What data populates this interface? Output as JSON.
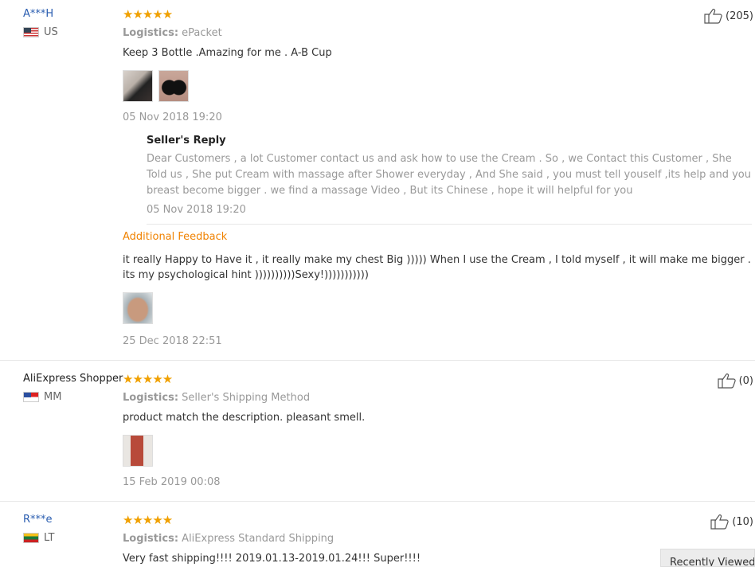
{
  "reviews": [
    {
      "user": "A***H",
      "country": "US",
      "stars": "★★★★★",
      "logistics_label": "Logistics:",
      "logistics": "ePacket",
      "text": "Keep 3 Bottle .Amazing for me . A-B Cup",
      "date": "05 Nov 2018 19:20",
      "helpful_count": "(205)",
      "seller_reply": {
        "title": "Seller's Reply",
        "text": "Dear Customers , a lot Customer contact us and ask how to use the Cream . So , we Contact this Customer , She Told us , She put Cream with massage after Shower everyday , And She said , you must tell youself ,its help and you breast become bigger . we find a massage Video , But its Chinese , hope it will helpful for you",
        "date": "05 Nov 2018 19:20"
      },
      "additional": {
        "title": "Additional Feedback",
        "text": "it really Happy to Have it , it really make my chest Big ))))) When I use the Cream , I told myself , it will make me bigger . its my psychological hint ))))))))))Sexy!)))))))))))",
        "date": "25 Dec 2018 22:51"
      }
    },
    {
      "user": "AliExpress Shopper",
      "country": "MM",
      "stars": "★★★★★",
      "logistics_label": "Logistics:",
      "logistics": "Seller's Shipping Method",
      "text": "product match the description. pleasant smell.",
      "date": "15 Feb 2019 00:08",
      "helpful_count": "(0)"
    },
    {
      "user": "R***e",
      "country": "LT",
      "stars": "★★★★★",
      "logistics_label": "Logistics:",
      "logistics": "AliExpress Standard Shipping",
      "text": "Very fast shipping!!!! 2019.01.13-2019.01.24!!! Super!!!!",
      "helpful_count": "(10)"
    }
  ],
  "recently_viewed": "Recently Viewed",
  "icons": {
    "thumbs_up": "thumbs-up-icon",
    "star": "star-icon"
  },
  "colors": {
    "star": "#f0a000",
    "username_link": "#2a5db0",
    "additional_feedback": "#f08200"
  }
}
